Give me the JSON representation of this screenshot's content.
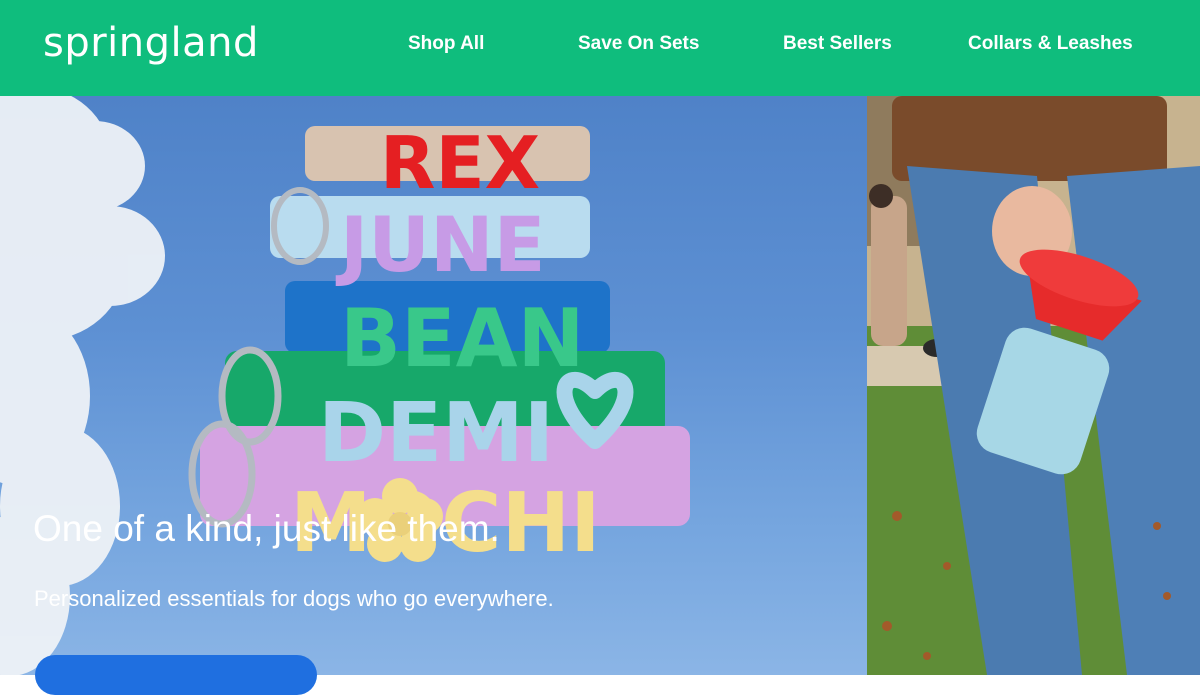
{
  "header": {
    "logo": "springland",
    "nav": [
      "Shop All",
      "Save On Sets",
      "Best Sellers",
      "Collars & Leashes"
    ]
  },
  "hero": {
    "headline": "One of a kind, just like them.",
    "subtext": "Personalized essentials for dogs who go everywhere.",
    "collar_names": [
      "REX",
      "JUNE",
      "BEAN",
      "DEMI",
      "MOCHI"
    ]
  },
  "colors": {
    "brand_green": "#0fbd7d",
    "sky_blue": "#5d90d3",
    "cta_blue": "#1f6fe0"
  },
  "icons": [
    "heart-icon",
    "flower-icon"
  ]
}
